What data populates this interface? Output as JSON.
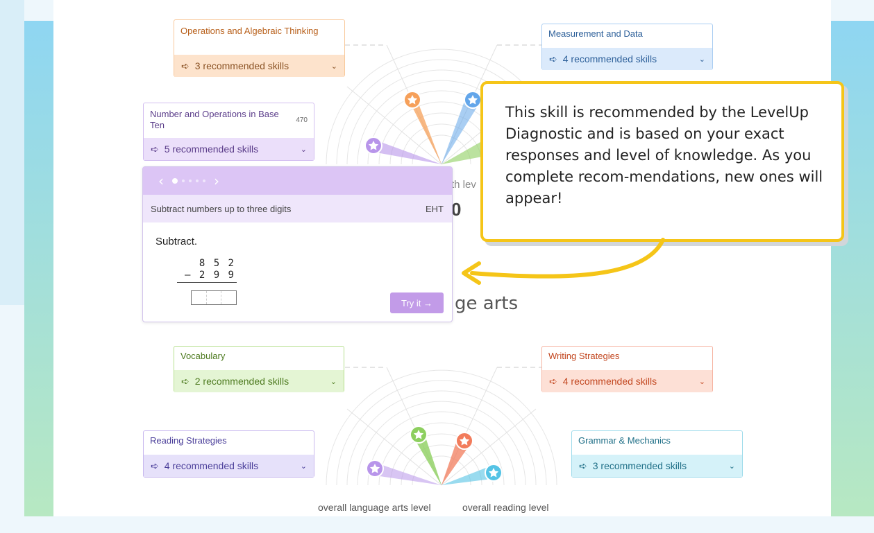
{
  "colors": {
    "orange": "#f6a05a",
    "blue": "#63a6ea",
    "purple": "#b895ea",
    "green": "#8dcf5f",
    "coral": "#f27c5c",
    "cyan": "#55c3e5",
    "callout_border": "#f5c518"
  },
  "math_cards": [
    {
      "title": "Operations and Algebraic Thinking",
      "skills": "3 recommended skills"
    },
    {
      "title": "Measurement and Data",
      "skills": "4 recommended skills"
    },
    {
      "title": "Number and Operations in Base Ten",
      "score": "470",
      "skills": "5 recommended skills"
    }
  ],
  "ela_cards": [
    {
      "title": "Vocabulary",
      "skills": "2 recommended skills"
    },
    {
      "title": "Writing Strategies",
      "skills": "4 recommended skills"
    },
    {
      "title": "Reading Strategies",
      "skills": "4 recommended skills"
    },
    {
      "title": "Grammar & Mechanics",
      "skills": "3 recommended skills"
    }
  ],
  "popover": {
    "skill_title": "Subtract numbers up to three digits",
    "skill_code": "EHT",
    "prompt": "Subtract.",
    "minuend": "8 5 2",
    "subtrahend": "– 2 9 9",
    "try_label": "Try it →",
    "prev_label": "‹",
    "next_label": "›"
  },
  "partial_labels": {
    "math_level": "th lev",
    "math_score": "0",
    "section_title": "ge arts"
  },
  "bottom_labels": {
    "left": "overall language arts level",
    "right": "overall reading level"
  },
  "callout": {
    "text": "This skill is recommended by the LevelUp Diagnostic and is based on your exact responses and level of knowledge. As you complete recom-mendations, new ones will appear!"
  },
  "icons": {
    "recommend": "recommend-arrow-icon",
    "chevron": "chevron-down-icon",
    "star": "star-badge-icon"
  }
}
